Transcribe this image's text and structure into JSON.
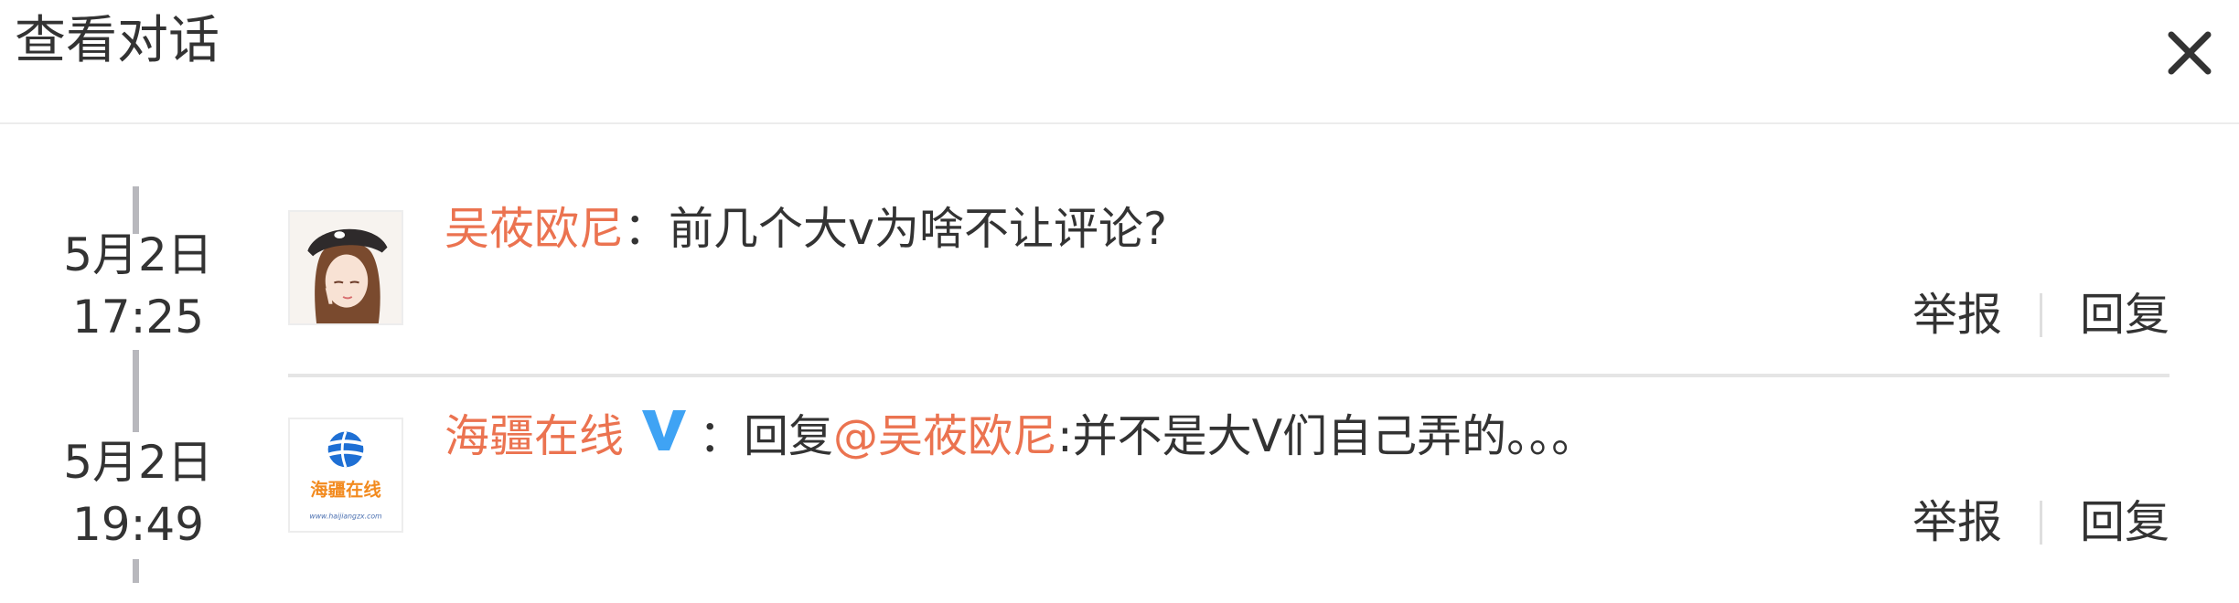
{
  "dialog": {
    "title": "查看对话"
  },
  "conversation": [
    {
      "date": "5月2日",
      "time": "17:25",
      "user": "吴莜欧尼",
      "colon": "：",
      "text": "前几个大v为啥不让评论?",
      "actions": {
        "report": "举报",
        "reply": "回复"
      }
    },
    {
      "date": "5月2日",
      "time": "19:49",
      "user": "海疆在线",
      "colon": "：",
      "reply_prefix": "回复",
      "mention": "@吴莜欧尼",
      "text": ":并不是大V们自己弄的。。。",
      "avatar_text": "海疆在线",
      "avatar_url": "www.haijiangzx.com",
      "actions": {
        "report": "举报",
        "reply": "回复"
      }
    }
  ],
  "colors": {
    "name": "#eb7350",
    "verified": "#3fa3f4",
    "text": "#333333"
  },
  "icons": {
    "close": "close-icon",
    "verified": "verified-v-icon"
  }
}
